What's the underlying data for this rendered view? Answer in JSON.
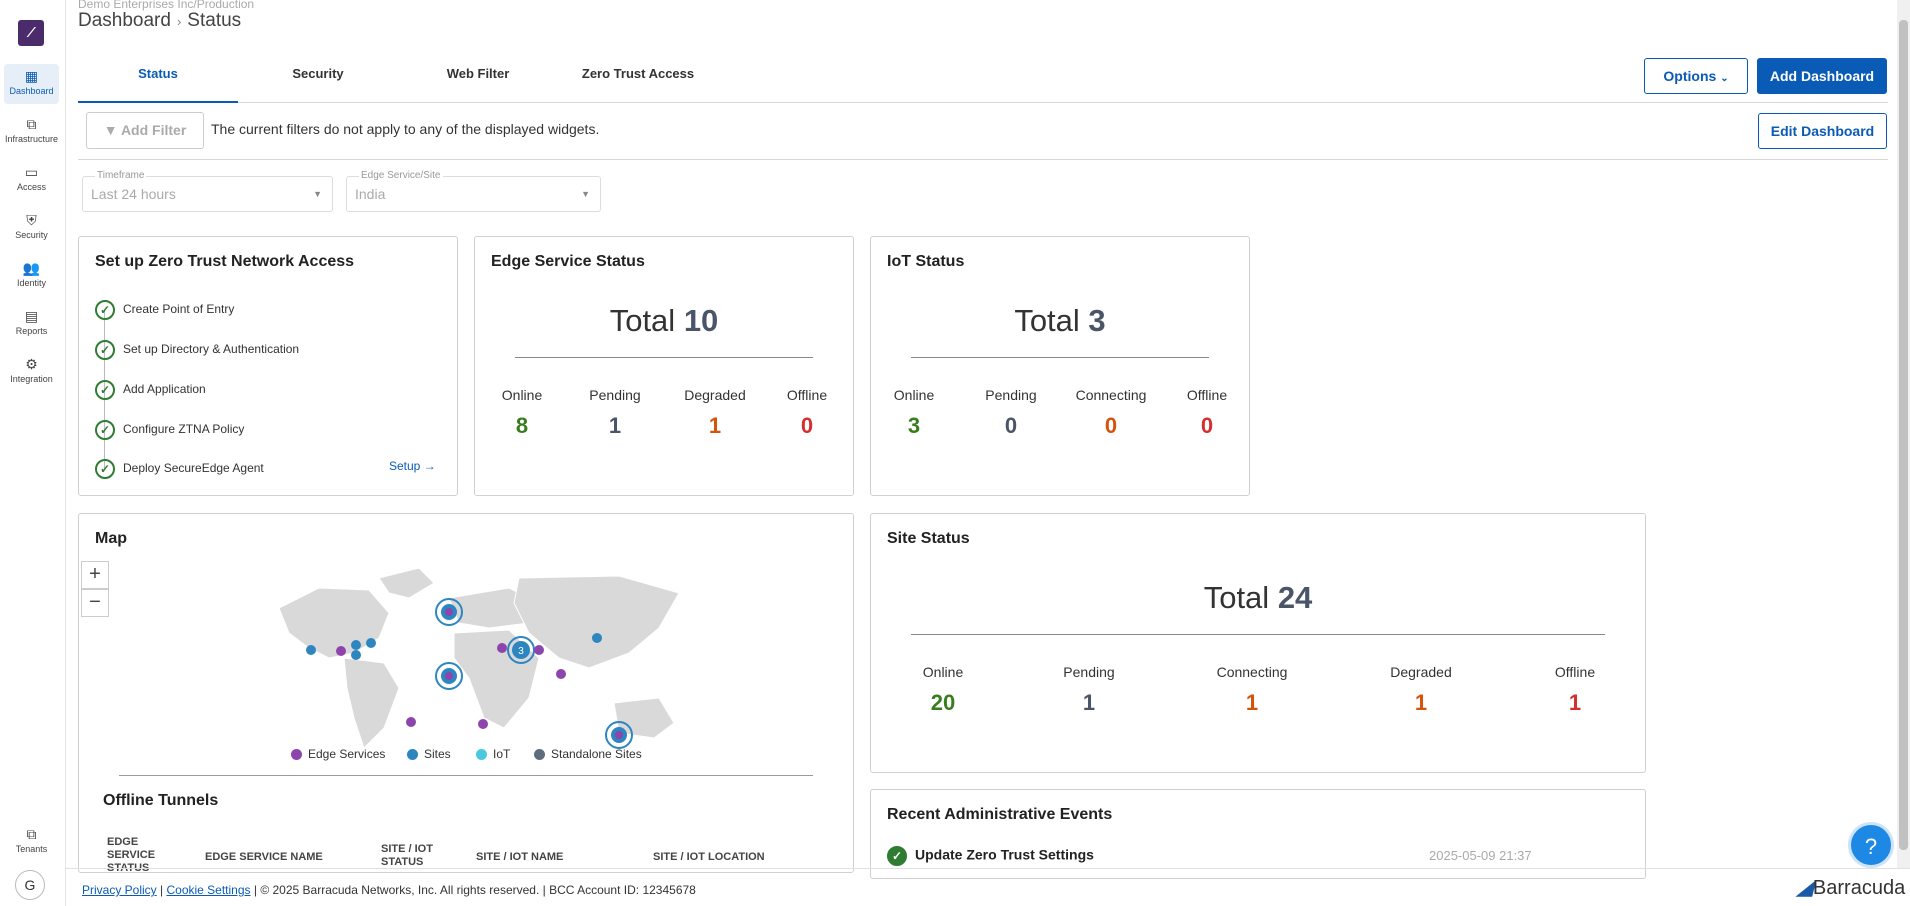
{
  "sidebar": {
    "items": [
      {
        "label": "Dashboard",
        "icon": "grid-icon"
      },
      {
        "label": "Infrastructure",
        "icon": "hierarchy-icon"
      },
      {
        "label": "Access",
        "icon": "monitor-icon"
      },
      {
        "label": "Security",
        "icon": "shield-icon"
      },
      {
        "label": "Identity",
        "icon": "people-icon"
      },
      {
        "label": "Reports",
        "icon": "report-icon"
      },
      {
        "label": "Integration",
        "icon": "gear-icon"
      }
    ],
    "tenants_label": "Tenants",
    "avatar_initial": "G"
  },
  "header": {
    "org": "Demo Enterprises Inc/Production",
    "crumb_root": "Dashboard",
    "crumb_sep": "›",
    "crumb_current": "Status"
  },
  "tabs": [
    "Status",
    "Security",
    "Web Filter",
    "Zero Trust Access"
  ],
  "buttons": {
    "options": "Options",
    "add_dashboard": "Add Dashboard",
    "edit_dashboard": "Edit Dashboard",
    "add_filter": "Add Filter"
  },
  "filter_message": "The current filters do not apply to any of the displayed widgets.",
  "timeframe": {
    "label": "Timeframe",
    "value": "Last 24 hours"
  },
  "edge_site": {
    "label": "Edge Service/Site",
    "value": "India"
  },
  "ztna": {
    "title": "Set up Zero Trust Network Access",
    "steps": [
      "Create Point of Entry",
      "Set up Directory & Authentication",
      "Add Application",
      "Configure ZTNA Policy",
      "Deploy SecureEdge Agent"
    ],
    "setup_link": "Setup"
  },
  "edge_status": {
    "title": "Edge Service Status",
    "total_label": "Total",
    "total": "10",
    "stats": [
      {
        "label": "Online",
        "value": "8"
      },
      {
        "label": "Pending",
        "value": "1"
      },
      {
        "label": "Degraded",
        "value": "1"
      },
      {
        "label": "Offline",
        "value": "0"
      }
    ]
  },
  "iot_status": {
    "title": "IoT Status",
    "total_label": "Total",
    "total": "3",
    "stats": [
      {
        "label": "Online",
        "value": "3"
      },
      {
        "label": "Pending",
        "value": "0"
      },
      {
        "label": "Connecting",
        "value": "0"
      },
      {
        "label": "Offline",
        "value": "0"
      }
    ]
  },
  "map": {
    "title": "Map",
    "cluster_count": "3",
    "legend": [
      "Edge Services",
      "Sites",
      "IoT",
      "Standalone Sites"
    ],
    "colors": {
      "edge": "#8e44ad",
      "sites": "#2e86c1",
      "iot": "#48c9e0",
      "standalone": "#5d6d7e"
    }
  },
  "offline_tunnels": {
    "title": "Offline Tunnels",
    "columns": [
      "Edge Service Status",
      "Edge Service Name",
      "Site / IoT Status",
      "Site / IoT Name",
      "Site / IoT Location"
    ]
  },
  "site_status": {
    "title": "Site Status",
    "total_label": "Total",
    "total": "24",
    "stats": [
      {
        "label": "Online",
        "value": "20"
      },
      {
        "label": "Pending",
        "value": "1"
      },
      {
        "label": "Connecting",
        "value": "1"
      },
      {
        "label": "Degraded",
        "value": "1"
      },
      {
        "label": "Offline",
        "value": "1"
      }
    ]
  },
  "admin_events": {
    "title": "Recent Administrative Events",
    "items": [
      {
        "text": "Update Zero Trust Settings",
        "time": "2025-05-09 21:37"
      }
    ]
  },
  "footer": {
    "privacy": "Privacy Policy",
    "cookies": "Cookie Settings",
    "copyright": "| © 2025 Barracuda Networks, Inc. All rights reserved. | BCC Account ID: 12345678",
    "brand": "Barracuda"
  }
}
